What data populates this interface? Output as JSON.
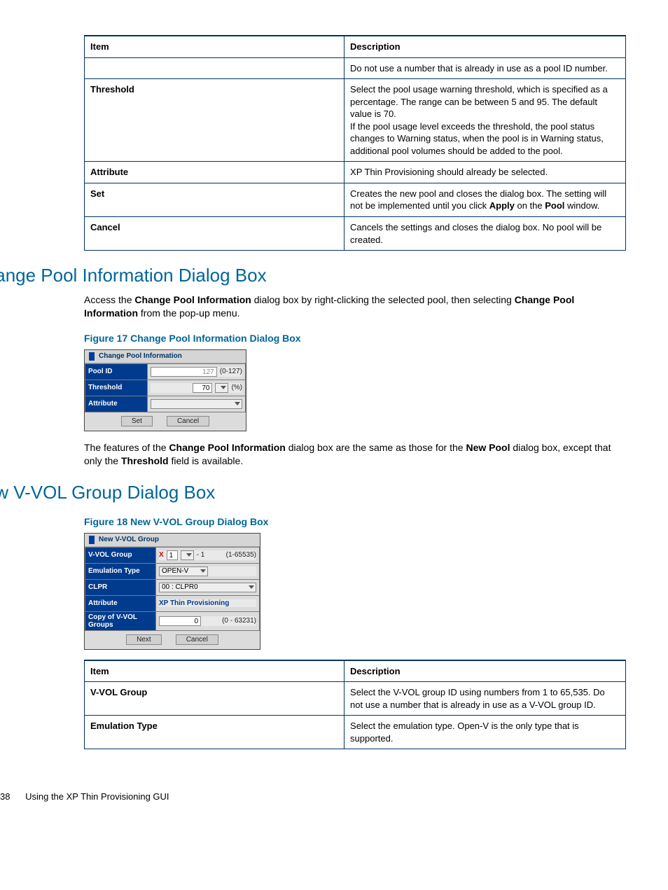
{
  "table1": {
    "headers": [
      "Item",
      "Description"
    ],
    "rows": [
      {
        "item": "",
        "desc_plain": "Do not use a number that is already in use as a pool ID number."
      },
      {
        "item": "Threshold",
        "desc_plain": "Select the pool usage warning threshold, which is specified as a percentage. The range can be between 5 and 95. The default value is 70.\nIf the pool usage level exceeds the threshold, the pool status changes to Warning status, when the pool is in Warning status, additional pool volumes should be added to the pool."
      },
      {
        "item": "Attribute",
        "desc_plain": "XP Thin Provisioning should already be selected."
      },
      {
        "item": "Set",
        "desc_html": "Creates the new pool and closes the dialog box. The setting will not be implemented until you click <b>Apply</b> on the <b>Pool</b> window."
      },
      {
        "item": "Cancel",
        "desc_plain": "Cancels the settings and closes the dialog box. No pool will be created."
      }
    ]
  },
  "section1": {
    "heading": "Change Pool Information Dialog Box",
    "intro_html": "Access the <b>Change Pool Information</b> dialog box by right-clicking the selected pool, then selecting <b>Change Pool Information</b> from the pop-up menu.",
    "figure_caption": "Figure 17 Change Pool Information Dialog Box",
    "dialog": {
      "title": "Change Pool Information",
      "rows": {
        "pool_id": {
          "label": "Pool ID",
          "value": "127",
          "range": "(0-127)"
        },
        "threshold": {
          "label": "Threshold",
          "value": "70",
          "unit": "(%)"
        },
        "attribute": {
          "label": "Attribute"
        }
      },
      "buttons": {
        "set": "Set",
        "cancel": "Cancel"
      }
    },
    "outro_html": "The features of the <b>Change Pool Information</b> dialog box are the same as those for the <b>New Pool</b> dialog box, except that only the <b>Threshold</b> field is available."
  },
  "section2": {
    "heading": "New V-VOL Group Dialog Box",
    "figure_caption": "Figure 18 New V-VOL Group Dialog Box",
    "dialog": {
      "title": "New V-VOL Group",
      "rows": {
        "vvol_group": {
          "label": "V-VOL Group",
          "prefix": "X",
          "value": "1",
          "suffix": "- 1",
          "range": "(1-65535)"
        },
        "emulation_type": {
          "label": "Emulation Type",
          "value": "OPEN-V"
        },
        "clpr": {
          "label": "CLPR",
          "value": "00 : CLPR0"
        },
        "attribute": {
          "label": "Attribute",
          "value": "XP Thin Provisioning"
        },
        "copy": {
          "label": "Copy of V-VOL Groups",
          "value": "0",
          "range": "(0 - 63231)"
        }
      },
      "buttons": {
        "next": "Next",
        "cancel": "Cancel"
      }
    }
  },
  "table2": {
    "headers": [
      "Item",
      "Description"
    ],
    "rows": [
      {
        "item": "V-VOL Group",
        "desc": "Select the V-VOL group ID using numbers from 1 to 65,535. Do not use a number that is already in use as a V-VOL group ID."
      },
      {
        "item": "Emulation Type",
        "desc": "Select the emulation type. Open-V is the only type that is supported."
      }
    ]
  },
  "footer": {
    "page": "38",
    "title": "Using the XP Thin Provisioning GUI"
  }
}
